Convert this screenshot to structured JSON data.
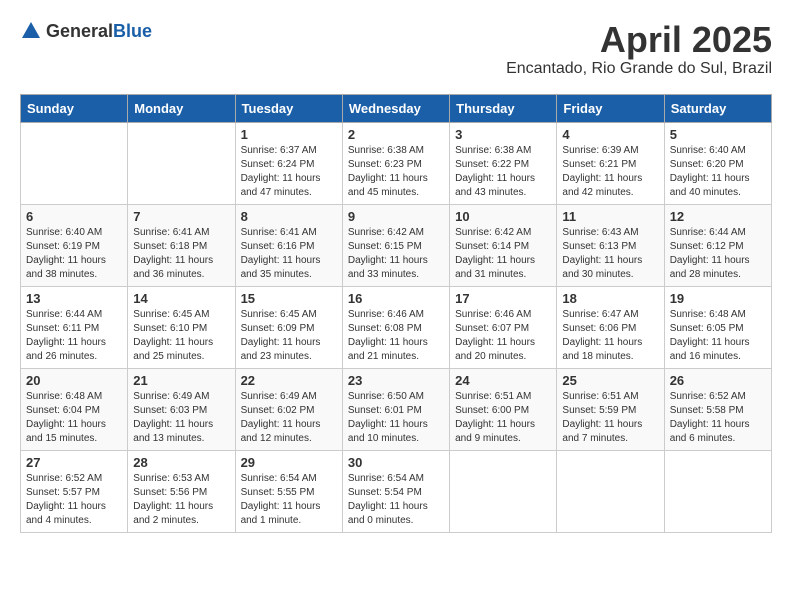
{
  "header": {
    "logo_general": "General",
    "logo_blue": "Blue",
    "title": "April 2025",
    "subtitle": "Encantado, Rio Grande do Sul, Brazil"
  },
  "days_of_week": [
    "Sunday",
    "Monday",
    "Tuesday",
    "Wednesday",
    "Thursday",
    "Friday",
    "Saturday"
  ],
  "weeks": [
    [
      {
        "day": "",
        "info": ""
      },
      {
        "day": "",
        "info": ""
      },
      {
        "day": "1",
        "info": "Sunrise: 6:37 AM\nSunset: 6:24 PM\nDaylight: 11 hours and 47 minutes."
      },
      {
        "day": "2",
        "info": "Sunrise: 6:38 AM\nSunset: 6:23 PM\nDaylight: 11 hours and 45 minutes."
      },
      {
        "day": "3",
        "info": "Sunrise: 6:38 AM\nSunset: 6:22 PM\nDaylight: 11 hours and 43 minutes."
      },
      {
        "day": "4",
        "info": "Sunrise: 6:39 AM\nSunset: 6:21 PM\nDaylight: 11 hours and 42 minutes."
      },
      {
        "day": "5",
        "info": "Sunrise: 6:40 AM\nSunset: 6:20 PM\nDaylight: 11 hours and 40 minutes."
      }
    ],
    [
      {
        "day": "6",
        "info": "Sunrise: 6:40 AM\nSunset: 6:19 PM\nDaylight: 11 hours and 38 minutes."
      },
      {
        "day": "7",
        "info": "Sunrise: 6:41 AM\nSunset: 6:18 PM\nDaylight: 11 hours and 36 minutes."
      },
      {
        "day": "8",
        "info": "Sunrise: 6:41 AM\nSunset: 6:16 PM\nDaylight: 11 hours and 35 minutes."
      },
      {
        "day": "9",
        "info": "Sunrise: 6:42 AM\nSunset: 6:15 PM\nDaylight: 11 hours and 33 minutes."
      },
      {
        "day": "10",
        "info": "Sunrise: 6:42 AM\nSunset: 6:14 PM\nDaylight: 11 hours and 31 minutes."
      },
      {
        "day": "11",
        "info": "Sunrise: 6:43 AM\nSunset: 6:13 PM\nDaylight: 11 hours and 30 minutes."
      },
      {
        "day": "12",
        "info": "Sunrise: 6:44 AM\nSunset: 6:12 PM\nDaylight: 11 hours and 28 minutes."
      }
    ],
    [
      {
        "day": "13",
        "info": "Sunrise: 6:44 AM\nSunset: 6:11 PM\nDaylight: 11 hours and 26 minutes."
      },
      {
        "day": "14",
        "info": "Sunrise: 6:45 AM\nSunset: 6:10 PM\nDaylight: 11 hours and 25 minutes."
      },
      {
        "day": "15",
        "info": "Sunrise: 6:45 AM\nSunset: 6:09 PM\nDaylight: 11 hours and 23 minutes."
      },
      {
        "day": "16",
        "info": "Sunrise: 6:46 AM\nSunset: 6:08 PM\nDaylight: 11 hours and 21 minutes."
      },
      {
        "day": "17",
        "info": "Sunrise: 6:46 AM\nSunset: 6:07 PM\nDaylight: 11 hours and 20 minutes."
      },
      {
        "day": "18",
        "info": "Sunrise: 6:47 AM\nSunset: 6:06 PM\nDaylight: 11 hours and 18 minutes."
      },
      {
        "day": "19",
        "info": "Sunrise: 6:48 AM\nSunset: 6:05 PM\nDaylight: 11 hours and 16 minutes."
      }
    ],
    [
      {
        "day": "20",
        "info": "Sunrise: 6:48 AM\nSunset: 6:04 PM\nDaylight: 11 hours and 15 minutes."
      },
      {
        "day": "21",
        "info": "Sunrise: 6:49 AM\nSunset: 6:03 PM\nDaylight: 11 hours and 13 minutes."
      },
      {
        "day": "22",
        "info": "Sunrise: 6:49 AM\nSunset: 6:02 PM\nDaylight: 11 hours and 12 minutes."
      },
      {
        "day": "23",
        "info": "Sunrise: 6:50 AM\nSunset: 6:01 PM\nDaylight: 11 hours and 10 minutes."
      },
      {
        "day": "24",
        "info": "Sunrise: 6:51 AM\nSunset: 6:00 PM\nDaylight: 11 hours and 9 minutes."
      },
      {
        "day": "25",
        "info": "Sunrise: 6:51 AM\nSunset: 5:59 PM\nDaylight: 11 hours and 7 minutes."
      },
      {
        "day": "26",
        "info": "Sunrise: 6:52 AM\nSunset: 5:58 PM\nDaylight: 11 hours and 6 minutes."
      }
    ],
    [
      {
        "day": "27",
        "info": "Sunrise: 6:52 AM\nSunset: 5:57 PM\nDaylight: 11 hours and 4 minutes."
      },
      {
        "day": "28",
        "info": "Sunrise: 6:53 AM\nSunset: 5:56 PM\nDaylight: 11 hours and 2 minutes."
      },
      {
        "day": "29",
        "info": "Sunrise: 6:54 AM\nSunset: 5:55 PM\nDaylight: 11 hours and 1 minute."
      },
      {
        "day": "30",
        "info": "Sunrise: 6:54 AM\nSunset: 5:54 PM\nDaylight: 11 hours and 0 minutes."
      },
      {
        "day": "",
        "info": ""
      },
      {
        "day": "",
        "info": ""
      },
      {
        "day": "",
        "info": ""
      }
    ]
  ]
}
